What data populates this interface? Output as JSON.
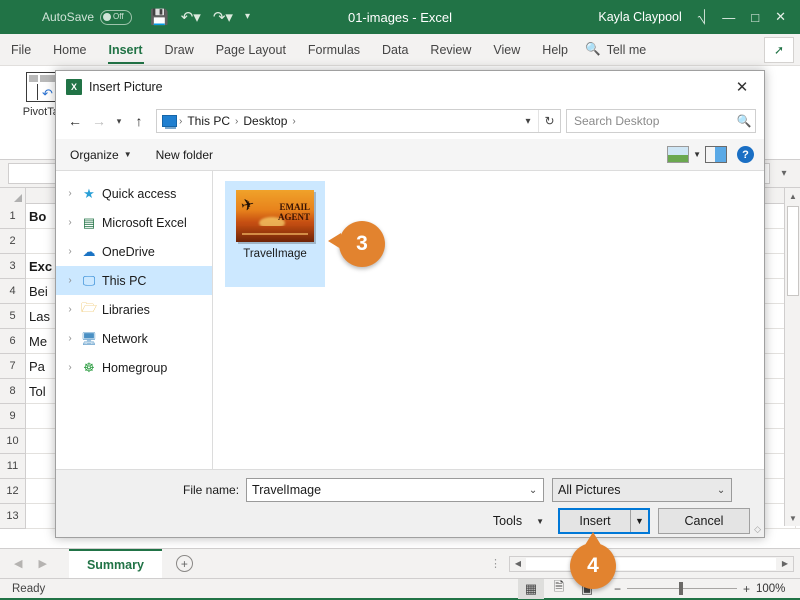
{
  "excel": {
    "titlebar": {
      "autosave_label": "AutoSave",
      "autosave_state": "Off",
      "save_icon": "save-icon",
      "undo_icon": "undo-icon",
      "redo_icon": "redo-icon",
      "customize_icon": "customize-qat-icon",
      "document_title": "01-images  -  Excel",
      "user_name": "Kayla Claypool",
      "ribbon_display_icon": "ribbon-display-options-icon",
      "minimize": "—",
      "maximize": "□",
      "close": "✕"
    },
    "ribbon_tabs": [
      {
        "label": "File",
        "active": false
      },
      {
        "label": "Home",
        "active": false
      },
      {
        "label": "Insert",
        "active": true
      },
      {
        "label": "Draw",
        "active": false
      },
      {
        "label": "Page Layout",
        "active": false
      },
      {
        "label": "Formulas",
        "active": false
      },
      {
        "label": "Data",
        "active": false
      },
      {
        "label": "Review",
        "active": false
      },
      {
        "label": "View",
        "active": false
      },
      {
        "label": "Help",
        "active": false
      }
    ],
    "tell_me": "Tell me",
    "share_icon": "share-icon",
    "ribbon": {
      "pivot_table_label": "PivotTal",
      "pivot_table_icon": "pivot-table-icon"
    },
    "formula_bar": {
      "name_box_value": "",
      "formula_value": "",
      "expand_icon": "chevron-down-icon"
    },
    "grid": {
      "row_headers": [
        "1",
        "2",
        "3",
        "4",
        "5",
        "6",
        "7",
        "8",
        "9",
        "10",
        "11",
        "12",
        "13"
      ],
      "column_a_values": [
        "Bo",
        "",
        "Exc",
        "Bei",
        "Las",
        "Me",
        "Pa",
        "Tol",
        "",
        "",
        "",
        "",
        ""
      ],
      "bold_rows": [
        1,
        3
      ]
    },
    "sheet_tabs": {
      "prev_icon": "prev-sheet-icon",
      "next_icon": "next-sheet-icon",
      "tabs": [
        "Summary"
      ],
      "add_sheet_icon": "add-sheet-icon"
    },
    "status_bar": {
      "status_text": "Ready",
      "view_normal_icon": "normal-view-icon",
      "view_pagelayout_icon": "page-layout-view-icon",
      "view_pagebreak_icon": "page-break-preview-icon",
      "zoom_out": "−",
      "zoom_in": "+",
      "zoom_level": "100%"
    }
  },
  "dialog": {
    "title": "Insert Picture",
    "app_icon": "excel-icon",
    "close_icon": "close-icon",
    "nav": {
      "back_icon": "back-arrow-icon",
      "forward_icon": "forward-arrow-icon",
      "recent_icon": "recent-locations-icon",
      "up_icon": "up-arrow-icon",
      "location_icon": "this-pc-icon",
      "breadcrumbs": [
        "This PC",
        "Desktop"
      ],
      "dropdown_icon": "chevron-down-icon",
      "refresh_icon": "refresh-icon"
    },
    "search": {
      "placeholder": "Search Desktop",
      "icon": "search-icon"
    },
    "toolbar": {
      "organize_label": "Organize",
      "organize_caret": "▼",
      "new_folder_label": "New folder",
      "view_icon": "change-view-icon",
      "view_caret": "▼",
      "preview_pane_icon": "preview-pane-icon",
      "help_icon": "help-icon",
      "help_glyph": "?"
    },
    "nav_pane": [
      {
        "label": "Quick access",
        "icon": "quick-access-star-icon",
        "selected": false
      },
      {
        "label": "Microsoft Excel",
        "icon": "excel-icon",
        "selected": false
      },
      {
        "label": "OneDrive",
        "icon": "onedrive-cloud-icon",
        "selected": false
      },
      {
        "label": "This PC",
        "icon": "this-pc-icon",
        "selected": true
      },
      {
        "label": "Libraries",
        "icon": "libraries-folder-icon",
        "selected": false
      },
      {
        "label": "Network",
        "icon": "network-icon",
        "selected": false
      },
      {
        "label": "Homegroup",
        "icon": "homegroup-icon",
        "selected": false
      }
    ],
    "files": [
      {
        "name": "TravelImage",
        "selected": true,
        "thumbnail_alt": "airplane-sunset-thumbnail",
        "thumbnail_text_line1": "EMAIL",
        "thumbnail_text_line2": "AGENT"
      }
    ],
    "bottom": {
      "file_name_label": "File name:",
      "file_name_value": "TravelImage",
      "file_name_caret": "⌄",
      "file_type_value": "All Pictures",
      "file_type_caret": "⌄",
      "tools_label": "Tools",
      "tools_caret": "▼",
      "insert_label": "Insert",
      "insert_caret": "▼",
      "cancel_label": "Cancel"
    }
  },
  "callouts": [
    {
      "number": "3",
      "direction": "left"
    },
    {
      "number": "4",
      "direction": "up"
    }
  ],
  "colors": {
    "excel_green": "#217346",
    "callout_orange": "#e2832f",
    "selection_blue": "#cce8ff",
    "focus_blue": "#0078d7"
  }
}
